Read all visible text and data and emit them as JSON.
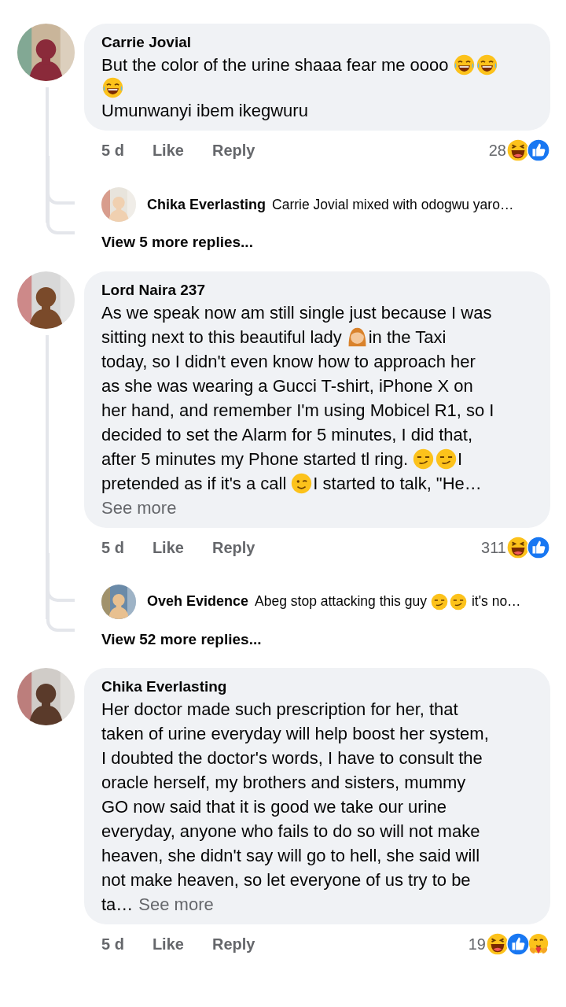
{
  "comments": [
    {
      "author": "Carrie Jovial",
      "lines": [
        [
          {
            "kind": "text",
            "text": "But the color of the urine shaaa fear me oooo"
          },
          {
            "kind": "tears_of_joy"
          },
          {
            "kind": "tears_of_joy"
          }
        ],
        [
          {
            "kind": "tears_of_joy"
          }
        ],
        [
          {
            "kind": "text",
            "text": "Umunwanyi ibem ikegwuru"
          }
        ]
      ],
      "time": "5 d",
      "like": "Like",
      "reply": "Reply",
      "reaction_count": "28",
      "reactions": [
        {
          "kind": "haha"
        },
        {
          "kind": "like"
        }
      ],
      "replies": [
        {
          "author": "Chika Everlasting",
          "segments": [
            {
              "kind": "text",
              "text": "Carrie Jovial mixed with odogwu yaro…"
            }
          ]
        }
      ],
      "more_replies": "View 5 more replies..."
    },
    {
      "author": "Lord Naira 237",
      "lines": [
        [
          {
            "kind": "text",
            "text": "As we speak now am still single just because I was"
          }
        ],
        [
          {
            "kind": "text",
            "text": "sitting next to this beautiful lady"
          },
          {
            "kind": "woman"
          },
          {
            "kind": "text",
            "text": "in the Taxi"
          }
        ],
        [
          {
            "kind": "text",
            "text": "today, so I didn't even know how to approach her"
          }
        ],
        [
          {
            "kind": "text",
            "text": "as she was wearing a Gucci T-shirt, iPhone X on"
          }
        ],
        [
          {
            "kind": "text",
            "text": "her hand, and remember I'm using Mobicel R1, so I"
          }
        ],
        [
          {
            "kind": "text",
            "text": "decided to set the Alarm for 5 minutes, I did that,"
          }
        ],
        [
          {
            "kind": "text",
            "text": "after 5 minutes my Phone started tl ring."
          },
          {
            "kind": "smirk"
          },
          {
            "kind": "smirk"
          },
          {
            "kind": "text",
            "text": "I"
          }
        ],
        [
          {
            "kind": "text",
            "text": "pretended as if it's a call"
          },
          {
            "kind": "wink"
          },
          {
            "kind": "text",
            "text": "I started to talk, \"He…"
          }
        ],
        [
          {
            "kind": "link",
            "text": "See more"
          }
        ]
      ],
      "time": "5 d",
      "like": "Like",
      "reply": "Reply",
      "reaction_count": "311",
      "reactions": [
        {
          "kind": "haha"
        },
        {
          "kind": "like"
        }
      ],
      "replies": [
        {
          "author": "Oveh Evidence",
          "segments": [
            {
              "kind": "text",
              "text": "Abeg stop attacking this guy"
            },
            {
              "kind": "smirk"
            },
            {
              "kind": "smirk"
            },
            {
              "kind": "text",
              "text": "it's no…"
            }
          ]
        }
      ],
      "more_replies": "View 52 more replies..."
    },
    {
      "author": "Chika Everlasting",
      "lines": [
        [
          {
            "kind": "text",
            "text": "Her doctor made such prescription for her, that"
          }
        ],
        [
          {
            "kind": "text",
            "text": "taken of urine everyday will help boost her system,"
          }
        ],
        [
          {
            "kind": "text",
            "text": "I doubted the doctor's words, I have to consult the"
          }
        ],
        [
          {
            "kind": "text",
            "text": "oracle herself, my brothers and sisters, mummy"
          }
        ],
        [
          {
            "kind": "text",
            "text": "GO now said that it is good we take our urine"
          }
        ],
        [
          {
            "kind": "text",
            "text": "everyday, anyone who fails to do so will not make"
          }
        ],
        [
          {
            "kind": "text",
            "text": "heaven, she didn't say will go to hell, she said will"
          }
        ],
        [
          {
            "kind": "text",
            "text": "not make heaven, so let everyone of us try to be"
          }
        ],
        [
          {
            "kind": "text",
            "text": "ta…"
          },
          {
            "kind": "link",
            "text": "See more"
          }
        ]
      ],
      "time": "5 d",
      "like": "Like",
      "reply": "Reply",
      "reaction_count": "19",
      "reactions": [
        {
          "kind": "haha"
        },
        {
          "kind": "like"
        },
        {
          "kind": "care"
        }
      ]
    }
  ]
}
